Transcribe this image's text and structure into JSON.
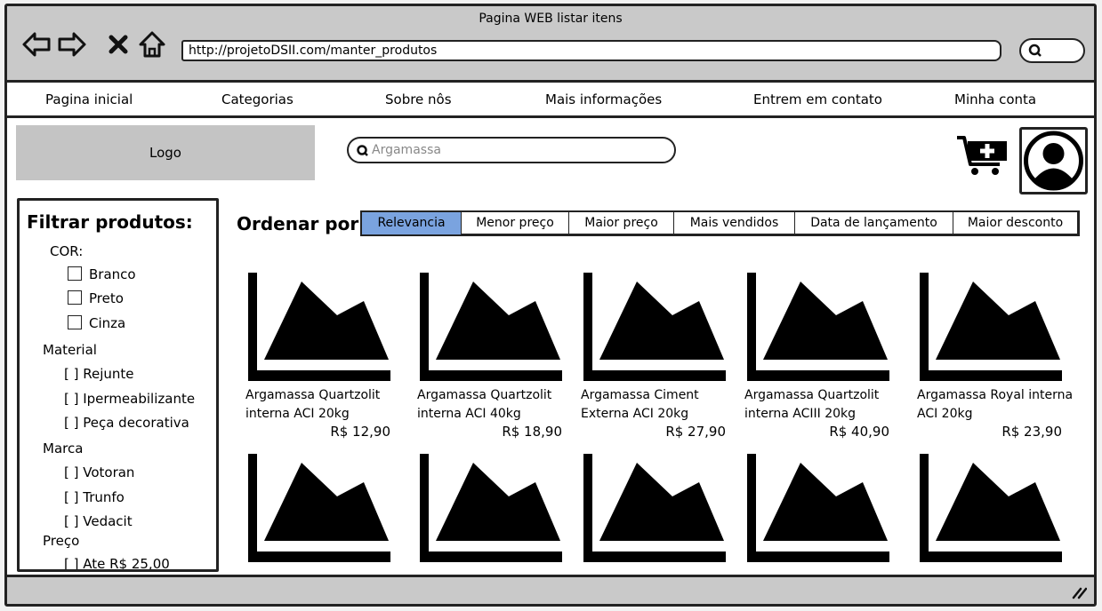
{
  "window": {
    "title": "Pagina WEB listar itens",
    "url": "http://projetoDSII.com/manter_produtos"
  },
  "browser_buttons": [
    {
      "icon": "back-arrow-icon"
    },
    {
      "icon": "forward-arrow-icon"
    },
    {
      "icon": "close-x-icon"
    },
    {
      "icon": "home-icon"
    }
  ],
  "menu": [
    "Pagina inicial",
    "Categorias",
    "Sobre nôs",
    "Mais informações",
    "Entrem em contato",
    "Minha conta"
  ],
  "header": {
    "logo": "Logo",
    "search_value": "Argamassa"
  },
  "filters": {
    "title": "Filtrar produtos:",
    "color_label": "COR:",
    "colors": [
      "Branco",
      "Preto",
      "Cinza"
    ],
    "material_label": "Material",
    "materials": [
      "[ ] Rejunte",
      "[ ] Ipermeabilizante",
      "[ ] Peça decorativa"
    ],
    "brand_label": "Marca",
    "brands": [
      "[ ] Votoran",
      "[ ] Trunfo",
      "[ ] Vedacit"
    ],
    "price_label": "Preço",
    "prices": [
      "[ ] Ate R$ 25,00"
    ]
  },
  "sort": {
    "label": "Ordenar por:",
    "options": [
      "Relevancia",
      "Menor preço",
      "Maior preço",
      "Mais vendidos",
      "Data de lançamento",
      "Maior desconto"
    ],
    "active": "Relevancia"
  },
  "products": [
    {
      "name": "Argamassa Quartzolit interna ACI 20kg",
      "price": "R$ 12,90"
    },
    {
      "name": "Argamassa Quartzolit interna ACI 40kg",
      "price": "R$ 18,90"
    },
    {
      "name": "Argamassa Ciment Externa ACI 20kg",
      "price": "R$ 27,90"
    },
    {
      "name": "Argamassa Quartzolit interna ACIII 20kg",
      "price": "R$ 40,90"
    },
    {
      "name": "Argamassa Royal interna ACI 20kg",
      "price": "R$ 23,90"
    },
    {
      "name": "",
      "price": ""
    },
    {
      "name": "",
      "price": ""
    },
    {
      "name": "",
      "price": ""
    },
    {
      "name": "",
      "price": ""
    },
    {
      "name": "",
      "price": ""
    }
  ],
  "colors": {
    "chrome": "#c9c9c9",
    "logo_bg": "#c4c4c4",
    "active_tab": "#7aa3df",
    "ink": "#000000"
  }
}
